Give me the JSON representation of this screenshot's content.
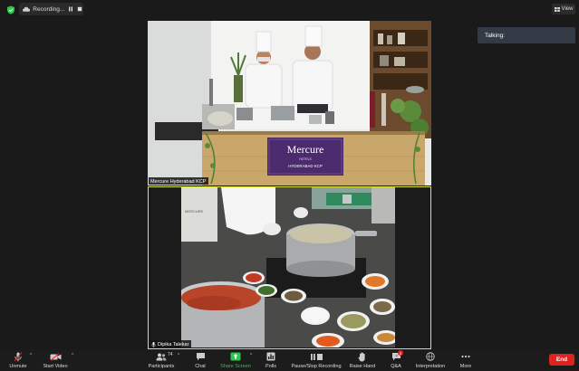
{
  "topbar": {
    "recording_label": "Recording...",
    "view_label": "View"
  },
  "talking_label": "Talking:",
  "tiles": [
    {
      "name": "Mercure Hyderabad KCP",
      "banner_brand": "Mercure",
      "banner_sub": "HOTELS",
      "banner_location": "HYDERABAD KCP",
      "apron_text": "MERCURE"
    },
    {
      "name": "Dipika Talekar"
    }
  ],
  "toolbar": {
    "unmute": "Unmute",
    "start_video": "Start Video",
    "participants": "Participants",
    "participants_count": "74",
    "chat": "Chat",
    "share_screen": "Share Screen",
    "polls": "Polls",
    "pause_recording": "Pause/Stop Recording",
    "raise_hand": "Raise Hand",
    "qa": "Q&A",
    "qa_badge": "1",
    "interpretation": "Interpretation",
    "more": "More",
    "end": "End"
  },
  "colors": {
    "background": "#1a1a1a",
    "active_speaker_border": "#d8e83a",
    "share_green": "#2cc84e",
    "end_red": "#e0231e",
    "banner_purple": "#4b2a6e"
  }
}
